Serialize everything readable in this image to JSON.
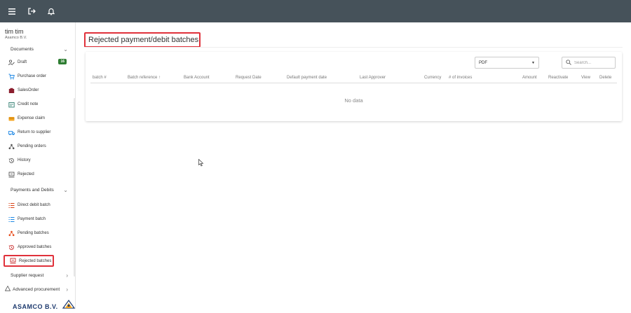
{
  "sidebar": {
    "user_name": "tim tim",
    "company": "Asamco B.V.",
    "documents_label": "Documents",
    "documents_items": [
      {
        "label": "Draft",
        "icon": "draft-icon",
        "badge": "16"
      },
      {
        "label": "Purchase order",
        "icon": "cart-icon"
      },
      {
        "label": "SalesOrder",
        "icon": "sales-order-icon"
      },
      {
        "label": "Credit note",
        "icon": "credit-note-icon"
      },
      {
        "label": "Expense claim",
        "icon": "expense-claim-icon"
      },
      {
        "label": "Return to supplier",
        "icon": "truck-icon"
      },
      {
        "label": "Pending orders",
        "icon": "pending-orders-icon"
      },
      {
        "label": "History",
        "icon": "history-icon"
      },
      {
        "label": "Rejected",
        "icon": "rejected-icon"
      }
    ],
    "payments_label": "Payments and Debits",
    "payments_items": [
      {
        "label": "Direct debit batch",
        "icon": "list-icon"
      },
      {
        "label": "Payment batch",
        "icon": "list-icon"
      },
      {
        "label": "Pending batches",
        "icon": "pending-batches-icon"
      },
      {
        "label": "Approved batches",
        "icon": "history-icon"
      },
      {
        "label": "Rejected batches",
        "icon": "rejected-icon"
      }
    ],
    "supplier_request_label": "Supplier request",
    "advanced_procurement_label": "Advanced procurement",
    "logo_text": "ASAMCO B.V."
  },
  "page": {
    "title": "Rejected payment/debit batches"
  },
  "toolbar": {
    "export_format": "PDF",
    "search_placeholder": "Search..."
  },
  "table": {
    "columns": [
      "batch #",
      "Batch reference ↑",
      "Bank Account",
      "Request Date",
      "Default payment date",
      "Last Approver",
      "Currency",
      "# of invoices",
      "Amount",
      "Reactivate",
      "View",
      "Delete"
    ],
    "empty_text": "No data"
  },
  "colors": {
    "topbar": "#46525a",
    "highlight": "#e0313b",
    "badge": "#2e7d32"
  }
}
